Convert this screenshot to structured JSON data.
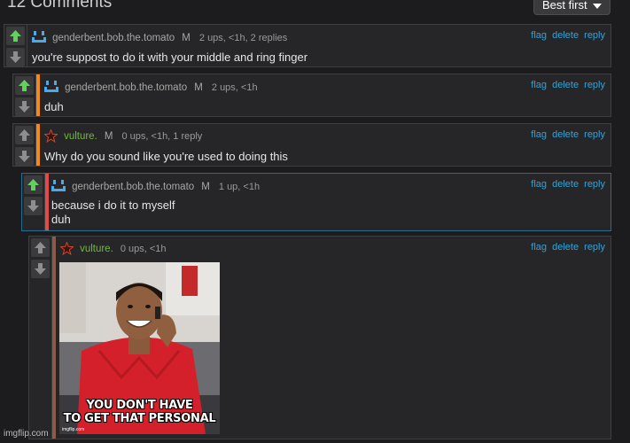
{
  "header": {
    "count": "12 Comments",
    "sort_label": "Best first"
  },
  "actions": {
    "flag": "flag",
    "delete": "delete",
    "reply": "reply"
  },
  "colors": {
    "accent_link": "#2fa4dc",
    "upvote": "#5fd35b",
    "user_green": "#6cbf2a",
    "stripe_orange": "#f08a1c",
    "stripe_red": "#e34b4b",
    "stripe_brown": "#8a5a4a"
  },
  "comments": [
    {
      "user": "genderbent.bob.the.tomato",
      "badge": "M",
      "stats": "2 ups, <1h, 2 replies",
      "text": "you're suppost to do it with your middle and ring finger",
      "avatar": "blue-face-icon",
      "upvoted": true
    },
    {
      "user": "genderbent.bob.the.tomato",
      "badge": "M",
      "stats": "2 ups, <1h",
      "text": "duh",
      "avatar": "blue-face-icon",
      "upvoted": false
    },
    {
      "user": "vulture.",
      "badge": "M",
      "stats": "0 ups, <1h, 1 reply",
      "text": "Why do you sound like you're used to doing this",
      "avatar": "star-icon",
      "upvoted": false
    },
    {
      "user": "genderbent.bob.the.tomato",
      "badge": "M",
      "stats": "1 up, <1h",
      "text_lines": [
        "because i do it to myself",
        "duh"
      ],
      "avatar": "blue-face-icon",
      "upvoted": true
    },
    {
      "user": "vulture.",
      "badge": "",
      "stats": "0 ups, <1h",
      "avatar": "star-icon",
      "upvoted": false,
      "meme": {
        "caption_lines": [
          "YOU DON'T HAVE",
          "TO GET THAT PERSONAL"
        ],
        "credit": "imgflip.com"
      }
    }
  ],
  "watermark": "imgflip.com"
}
